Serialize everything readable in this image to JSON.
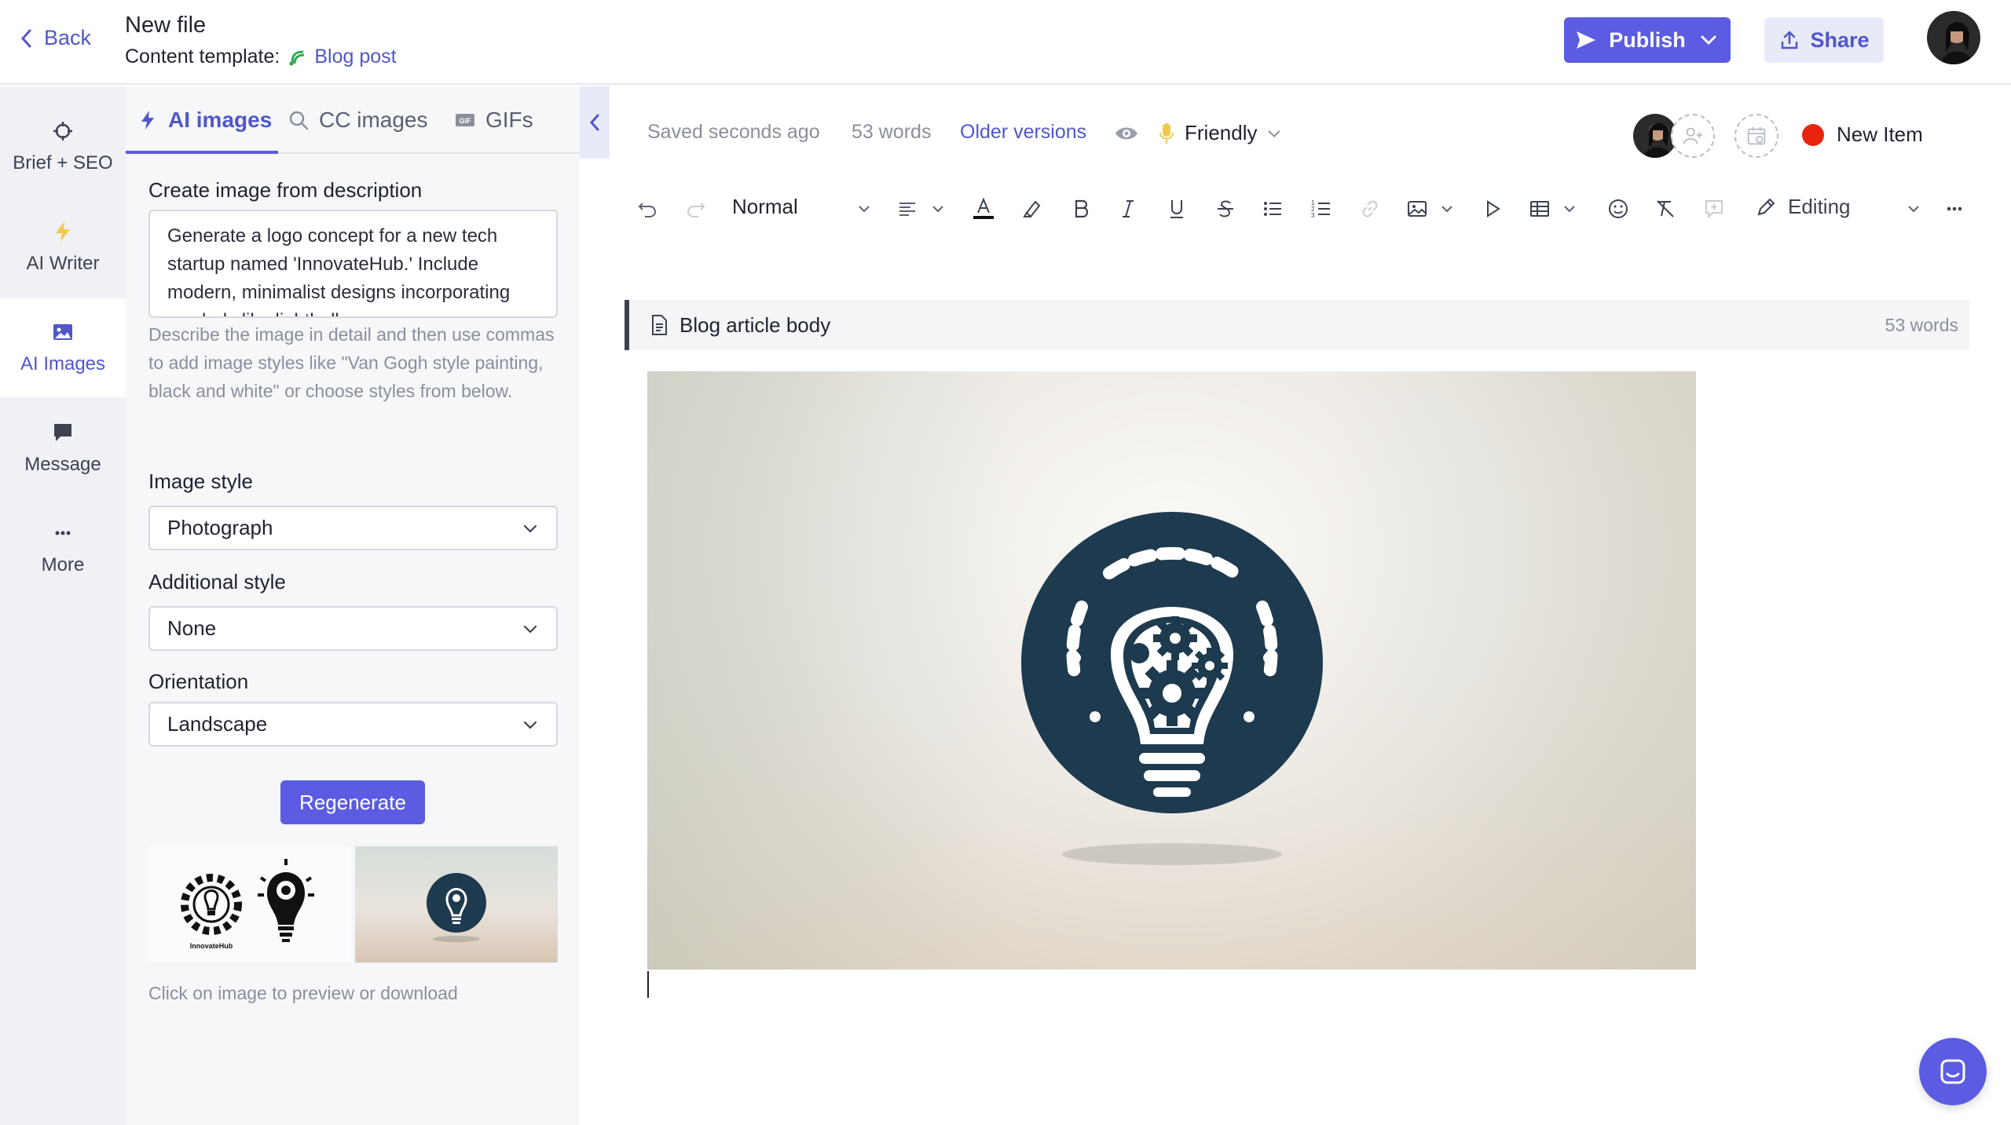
{
  "header": {
    "back_label": "Back",
    "file_title": "New file",
    "template_label": "Content template:",
    "template_name": "Blog post",
    "publish_label": "Publish",
    "share_label": "Share"
  },
  "rail": {
    "items": [
      {
        "label": "Brief + SEO",
        "icon": "crosshair-icon"
      },
      {
        "label": "AI Writer",
        "icon": "lightning-icon"
      },
      {
        "label": "AI Images",
        "icon": "image-icon"
      },
      {
        "label": "Message",
        "icon": "message-icon"
      },
      {
        "label": "More",
        "icon": "more-icon"
      }
    ],
    "active": "AI Images"
  },
  "panel": {
    "tabs": [
      {
        "label": "AI images",
        "icon": "lightning-icon"
      },
      {
        "label": "CC images",
        "icon": "search-icon"
      },
      {
        "label": "GIFs",
        "icon": "gif-icon"
      }
    ],
    "description_label": "Create image from description",
    "description_value": "Generate a logo concept for a new tech startup named 'InnovateHub.' Include modern, minimalist designs incorporating symbols like lightbulbs or gears.",
    "description_hint": "Describe the image in detail and then use commas to add image styles like \"Van Gogh style painting, black and white\" or choose styles from below.",
    "image_style_label": "Image style",
    "image_style_value": "Photograph",
    "additional_style_label": "Additional style",
    "additional_style_value": "None",
    "orientation_label": "Orientation",
    "orientation_value": "Landscape",
    "regenerate_label": "Regenerate",
    "thumb_caption": "Click on image to preview or download",
    "thumb1_text": "InnovateHub"
  },
  "editor": {
    "saved_status": "Saved seconds ago",
    "word_count": "53 words",
    "older_versions": "Older versions",
    "tone": "Friendly",
    "new_item": "New Item",
    "format": "Normal",
    "mode": "Editing",
    "section_title": "Blog article body",
    "section_words": "53 words"
  },
  "colors": {
    "accent": "#5b5ce2",
    "link": "#4f57c9",
    "status_dot": "#e8230c",
    "logo_navy": "#1e3a4f"
  }
}
